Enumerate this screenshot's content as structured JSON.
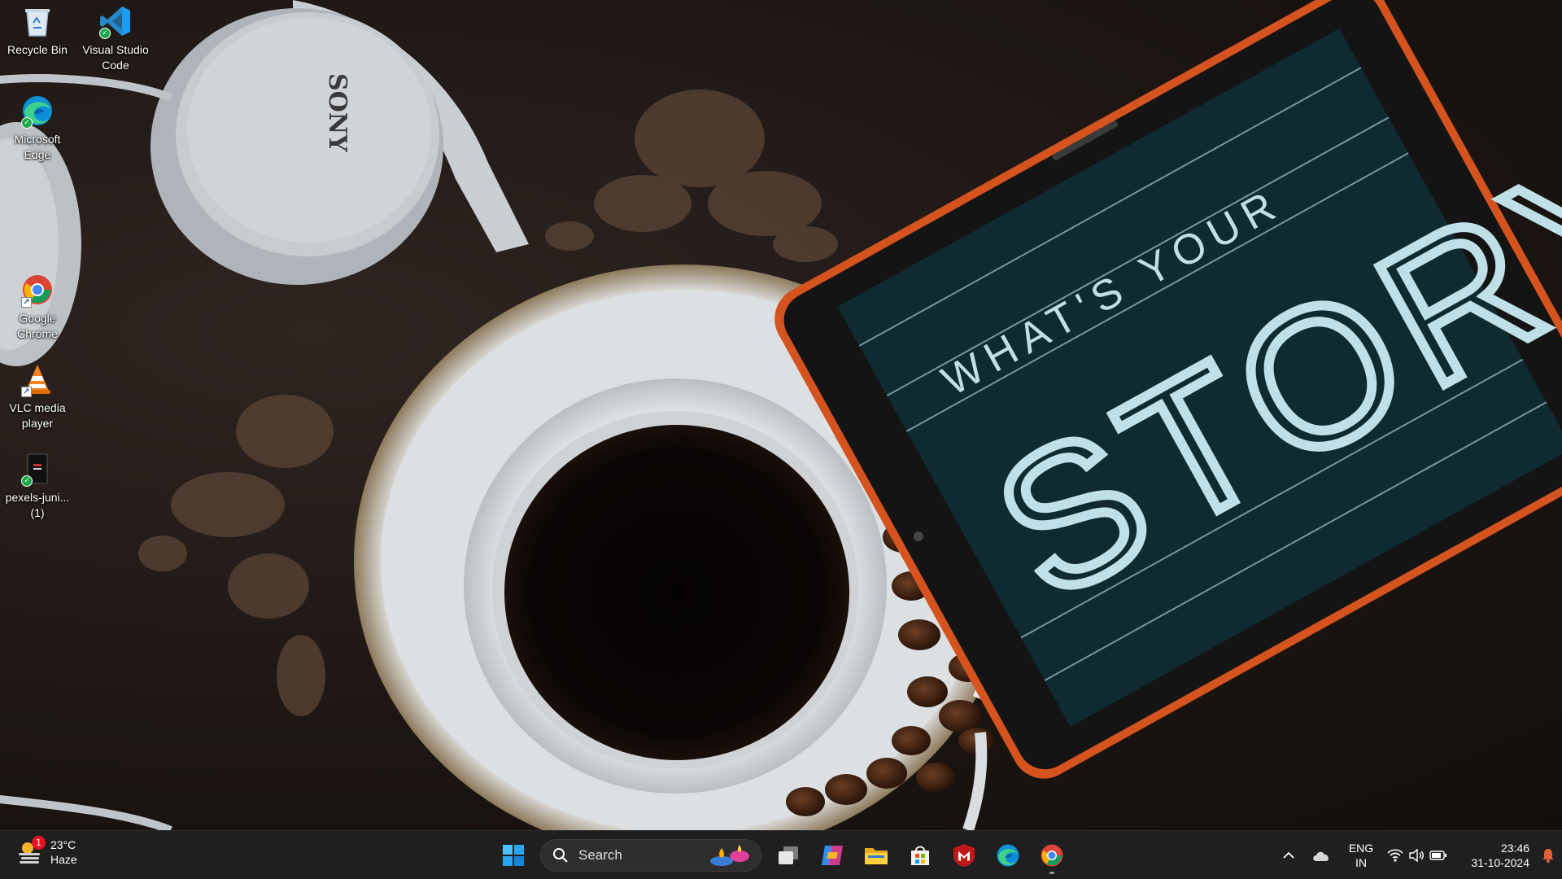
{
  "desktop": {
    "icons": [
      {
        "label": "Recycle Bin",
        "icon": "recycle-bin-icon"
      },
      {
        "label": "Visual Studio Code",
        "icon": "vscode-icon"
      },
      {
        "label": "Microsoft Edge",
        "icon": "edge-icon"
      },
      {
        "label": "Google Chrome",
        "icon": "chrome-icon"
      },
      {
        "label": "VLC media player",
        "icon": "vlc-icon"
      },
      {
        "label": "pexels-juni... (1)",
        "icon": "image-file-icon"
      }
    ],
    "wallpaper": {
      "headphone_brand": "SONY",
      "chalk_small": "WHAT'S YOUR",
      "chalk_big": "STORY"
    }
  },
  "taskbar": {
    "weather": {
      "temp": "23°C",
      "condition": "Haze",
      "badge": "1"
    },
    "search": {
      "placeholder": "Search"
    },
    "pinned": [
      {
        "name": "start-button",
        "icon": "windows-logo-icon"
      },
      {
        "name": "task-view-button",
        "icon": "task-view-icon"
      },
      {
        "name": "copilot-button",
        "icon": "copilot-icon"
      },
      {
        "name": "file-explorer-button",
        "icon": "folder-icon"
      },
      {
        "name": "microsoft-store-button",
        "icon": "store-icon"
      },
      {
        "name": "mcafee-button",
        "icon": "mcafee-icon"
      },
      {
        "name": "edge-taskbar-button",
        "icon": "edge-icon"
      },
      {
        "name": "chrome-taskbar-button",
        "icon": "chrome-icon"
      }
    ],
    "tray": {
      "language_line1": "ENG",
      "language_line2": "IN",
      "time": "23:46",
      "date": "31-10-2024"
    }
  },
  "colors": {
    "taskbar_bg": "#1f1f1f",
    "accent_blue": "#0078d4",
    "tablet_orange": "#d4531f",
    "chalkboard": "#0f2a30"
  }
}
